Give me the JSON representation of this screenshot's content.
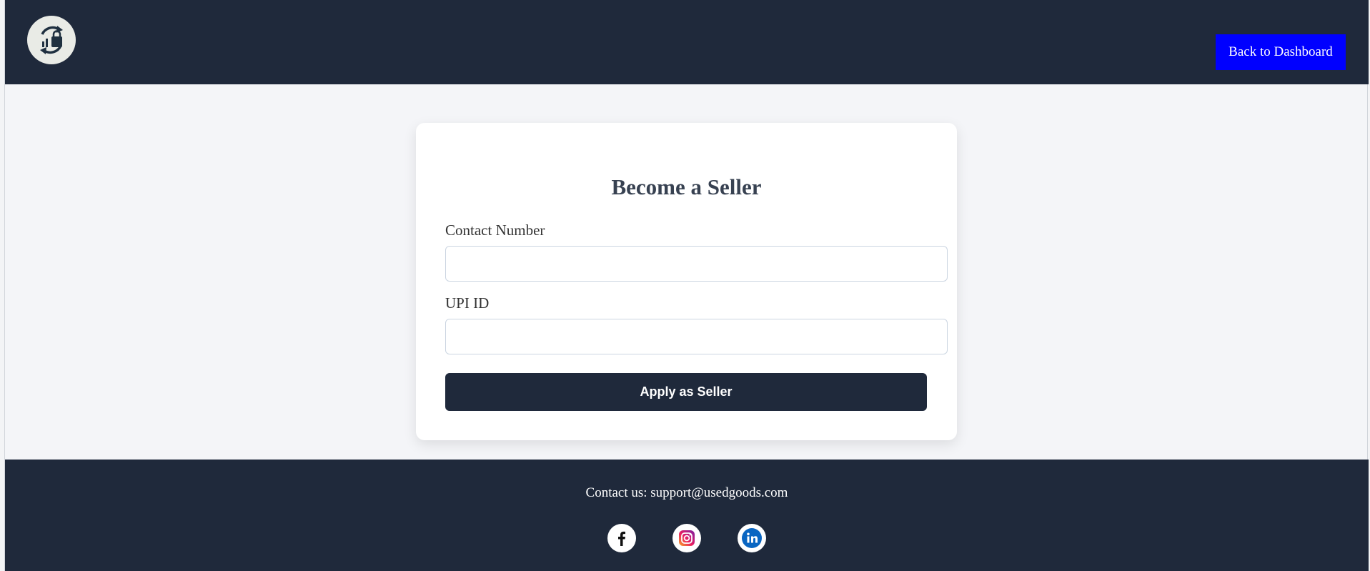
{
  "header": {
    "logo_icon": "recycle-bag-logo-icon",
    "back_button_label": "Back to Dashboard"
  },
  "form": {
    "title": "Become a Seller",
    "contact_label": "Contact Number",
    "contact_value": "",
    "upi_label": "UPI ID",
    "upi_value": "",
    "submit_label": "Apply as Seller"
  },
  "footer": {
    "contact_text": "Contact us: support@usedgoods.com",
    "social": [
      "facebook-icon",
      "instagram-icon",
      "linkedin-icon"
    ]
  },
  "colors": {
    "header_bg": "#1f293b",
    "accent_button": "#0000ff",
    "page_bg": "#f4f5f8"
  }
}
